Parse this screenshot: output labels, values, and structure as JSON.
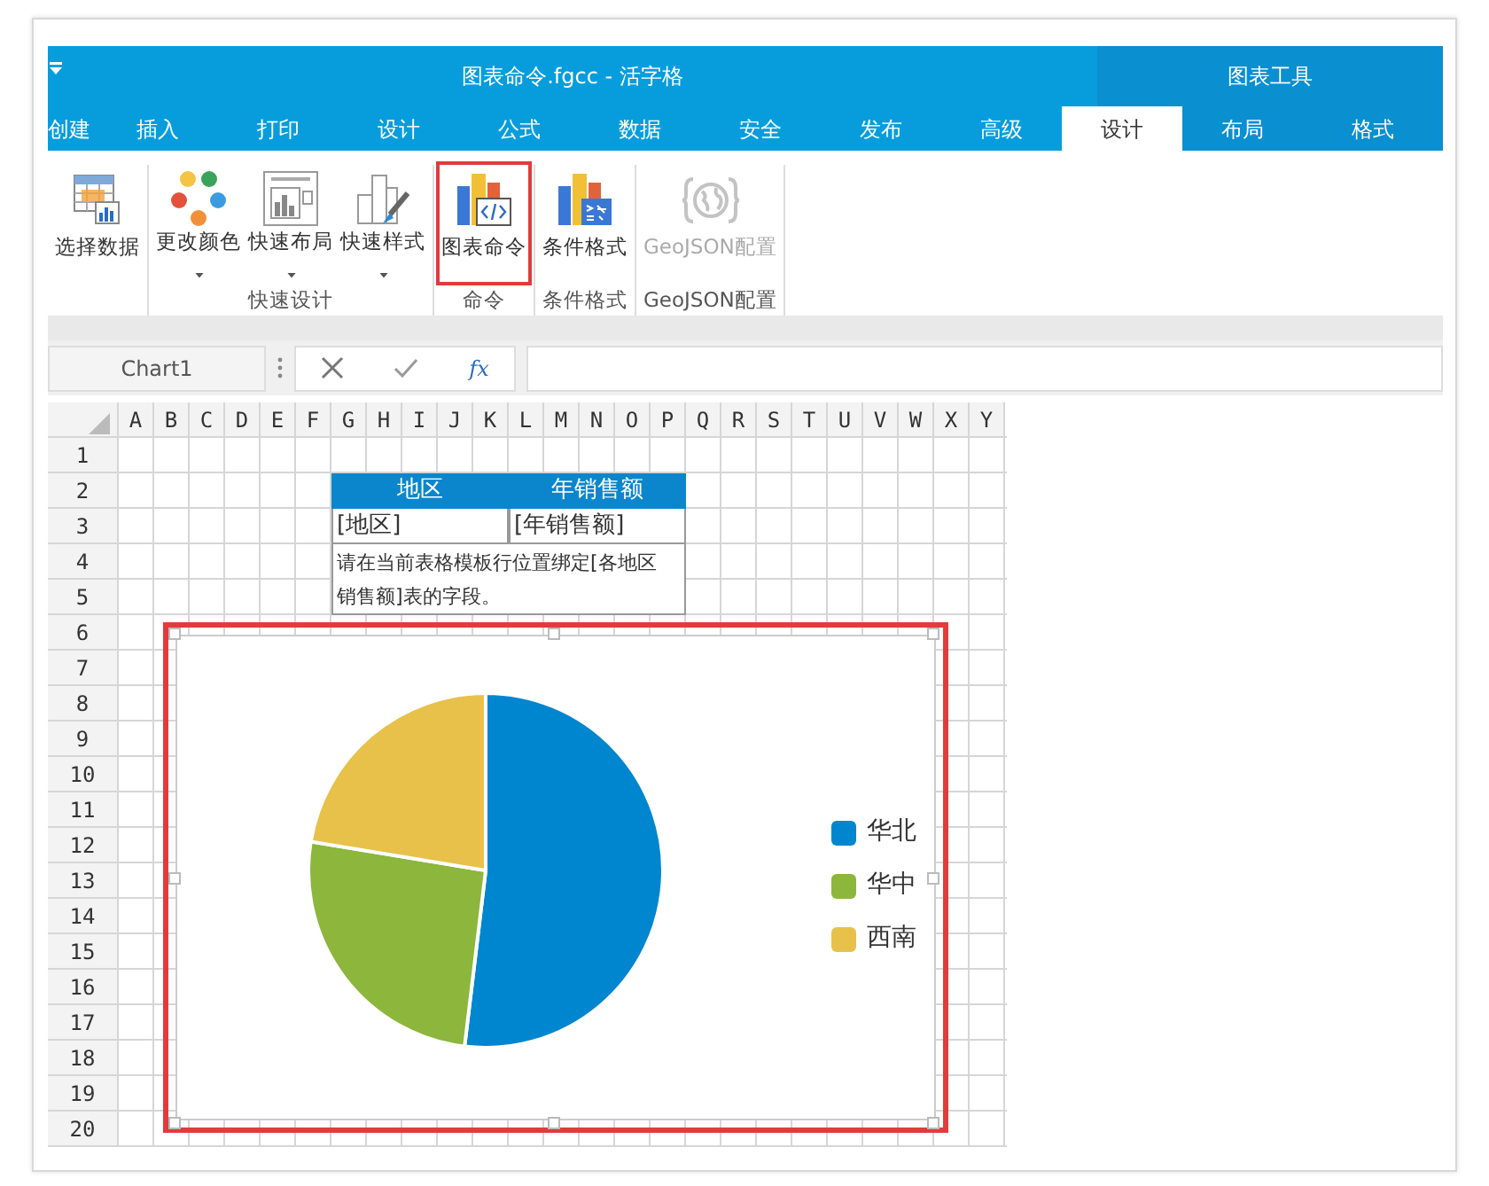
{
  "title_bar": {
    "title": "图表命令.fgcc - 活字格",
    "context_title": "图表工具"
  },
  "tabs": [
    {
      "label": "创建",
      "selected": false,
      "contextual": false
    },
    {
      "label": "插入",
      "selected": false,
      "contextual": false
    },
    {
      "label": "打印",
      "selected": false,
      "contextual": false
    },
    {
      "label": "设计",
      "selected": false,
      "contextual": false
    },
    {
      "label": "公式",
      "selected": false,
      "contextual": false
    },
    {
      "label": "数据",
      "selected": false,
      "contextual": false
    },
    {
      "label": "安全",
      "selected": false,
      "contextual": false
    },
    {
      "label": "发布",
      "selected": false,
      "contextual": false
    },
    {
      "label": "高级",
      "selected": false,
      "contextual": false
    },
    {
      "label": "设计",
      "selected": true,
      "contextual": true
    },
    {
      "label": "布局",
      "selected": false,
      "contextual": true
    },
    {
      "label": "格式",
      "selected": false,
      "contextual": true
    }
  ],
  "ribbon": {
    "groups": [
      {
        "buttons": [
          {
            "label": "选择数据",
            "dropdown": false,
            "highlighted": false,
            "disabled": false
          }
        ]
      },
      {
        "label": "快速设计",
        "buttons": [
          {
            "label": "更改颜色",
            "dropdown": true,
            "highlighted": false,
            "disabled": false
          },
          {
            "label": "快速布局",
            "dropdown": true,
            "highlighted": false,
            "disabled": false
          },
          {
            "label": "快速样式",
            "dropdown": true,
            "highlighted": false,
            "disabled": false
          }
        ]
      },
      {
        "label": "命令",
        "buttons": [
          {
            "label": "图表命令",
            "dropdown": false,
            "highlighted": true,
            "disabled": false
          }
        ]
      },
      {
        "label": "条件格式",
        "buttons": [
          {
            "label": "条件格式",
            "dropdown": false,
            "highlighted": false,
            "disabled": false
          }
        ]
      },
      {
        "label": "GeoJSON配置",
        "buttons": [
          {
            "label": "GeoJSON配置",
            "dropdown": false,
            "highlighted": false,
            "disabled": true
          }
        ]
      }
    ]
  },
  "formula_bar": {
    "name_box": "Chart1",
    "fx": "fx"
  },
  "sheet": {
    "columns": [
      "A",
      "B",
      "C",
      "D",
      "E",
      "F",
      "G",
      "H",
      "I",
      "J",
      "K",
      "L",
      "M",
      "N",
      "O",
      "P",
      "Q",
      "R",
      "S",
      "T",
      "U",
      "V",
      "W",
      "X",
      "Y"
    ],
    "rows": [
      "1",
      "2",
      "3",
      "4",
      "5",
      "6",
      "7",
      "8",
      "9",
      "10",
      "11",
      "12",
      "13",
      "14",
      "15",
      "16",
      "17",
      "18",
      "19",
      "20"
    ],
    "template": {
      "headers": [
        "地区",
        "年销售额"
      ],
      "fields": [
        "[地区]",
        "[年销售额]"
      ],
      "note": "请在当前表格模板行位置绑定[各地区销售额]表的字段。"
    }
  },
  "chart": {
    "selected": true,
    "legend": [
      {
        "label": "华北",
        "color": "#0086cf"
      },
      {
        "label": "华中",
        "color": "#8db63c"
      },
      {
        "label": "西南",
        "color": "#e8c14b"
      }
    ]
  }
}
